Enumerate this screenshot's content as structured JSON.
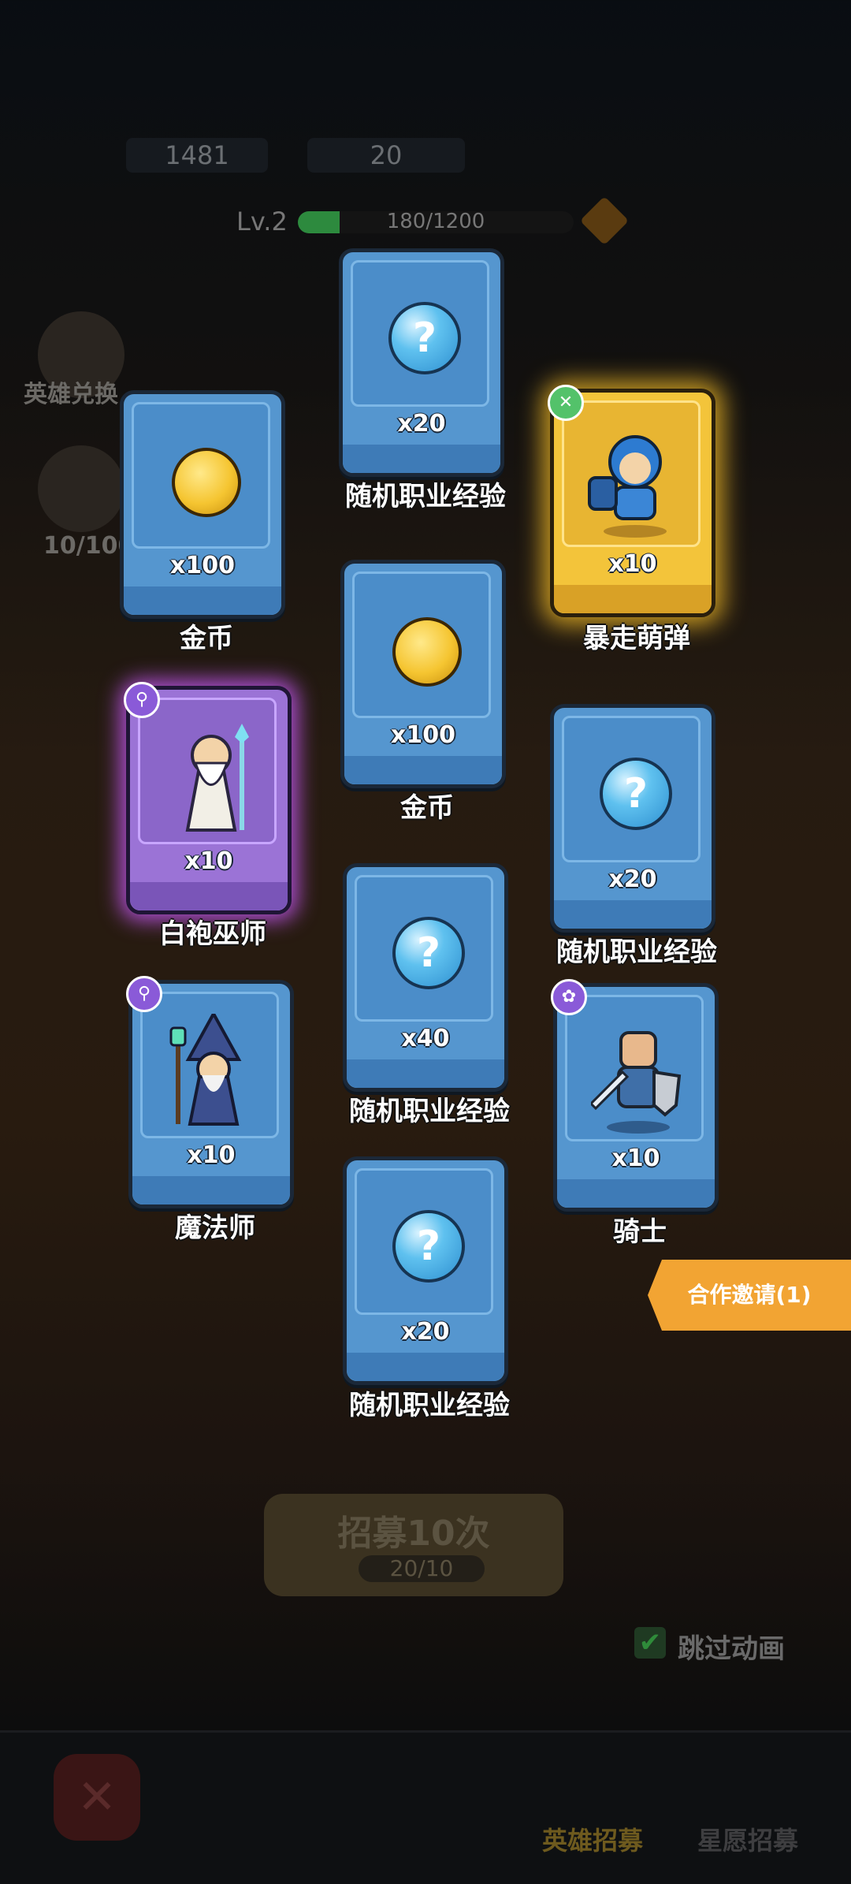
{
  "hud": {
    "gems": "1481",
    "tickets": "20",
    "level": "Lv.2",
    "xp": "180/1200",
    "xp_fraction": 0.15
  },
  "side": {
    "hero_exchange": "英雄兑换",
    "progress": "10/100"
  },
  "rewards": [
    {
      "qty": "x20",
      "name": "随机职业经验",
      "type": "orb"
    },
    {
      "qty": "x100",
      "name": "金币",
      "type": "coin"
    },
    {
      "qty": "x10",
      "name": "暴走萌弹",
      "type": "hero-gold"
    },
    {
      "qty": "x100",
      "name": "金币",
      "type": "coin"
    },
    {
      "qty": "x10",
      "name": "白袍巫师",
      "type": "hero-purple"
    },
    {
      "qty": "x20",
      "name": "随机职业经验",
      "type": "orb"
    },
    {
      "qty": "x40",
      "name": "随机职业经验",
      "type": "orb"
    },
    {
      "qty": "x10",
      "name": "魔法师",
      "type": "hero"
    },
    {
      "qty": "x10",
      "name": "骑士",
      "type": "hero"
    },
    {
      "qty": "x20",
      "name": "随机职业经验",
      "type": "orb"
    }
  ],
  "coop_label": "合作邀请(1)",
  "recruit": {
    "title": "招募10次",
    "count": "20/10"
  },
  "skip_label": "跳过动画",
  "tabs": {
    "hero": "英雄招募",
    "wish": "星愿招募"
  },
  "colors": {
    "card_blue": "#5596cf",
    "gold_glow": "#ffc428",
    "purple_glow": "#cd5aff",
    "coop": "#f2a433"
  }
}
